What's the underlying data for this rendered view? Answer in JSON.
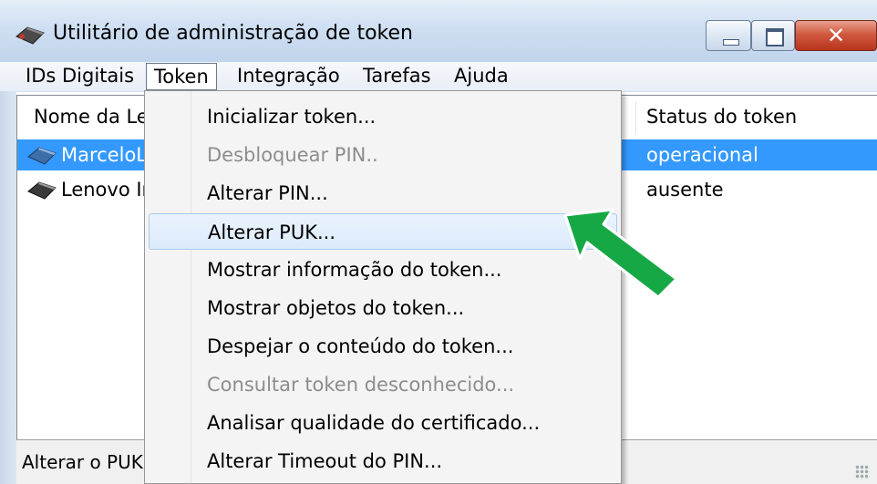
{
  "window": {
    "title": "Utilitário de administração de token",
    "close_glyph": "✕"
  },
  "menubar": {
    "items": [
      "IDs Digitais",
      "Token",
      "Integração",
      "Tarefas",
      "Ajuda"
    ]
  },
  "table": {
    "headers": [
      "Nome da Le",
      "Status do token"
    ],
    "rows": [
      {
        "name": "MarceloL",
        "status": "operacional",
        "selected": true
      },
      {
        "name": "Lenovo Ir",
        "status": "ausente",
        "selected": false
      }
    ]
  },
  "token_menu": {
    "items": [
      {
        "label": "Inicializar token...",
        "disabled": false
      },
      {
        "label": "Desbloquear PIN..",
        "disabled": true
      },
      {
        "label": "Alterar PIN...",
        "disabled": false
      },
      {
        "label": "Alterar PUK...",
        "disabled": false,
        "hover": true
      },
      {
        "label": "Mostrar informação do token...",
        "disabled": false
      },
      {
        "label": "Mostrar objetos do token...",
        "disabled": false
      },
      {
        "label": "Despejar o conteúdo do token...",
        "disabled": false
      },
      {
        "label": "Consultar token desconhecido...",
        "disabled": true
      },
      {
        "label": "Analisar qualidade do certificado...",
        "disabled": false
      },
      {
        "label": "Alterar Timeout do PIN...",
        "disabled": false
      }
    ]
  },
  "statusbar": {
    "text": "Alterar o PUK"
  },
  "colors": {
    "selection": "#3399ff",
    "arrow": "#17a846",
    "disabled_text": "#8d8d8d"
  },
  "icons": {
    "app": "token-device-icon",
    "arrow": "green-arrow-icon"
  }
}
